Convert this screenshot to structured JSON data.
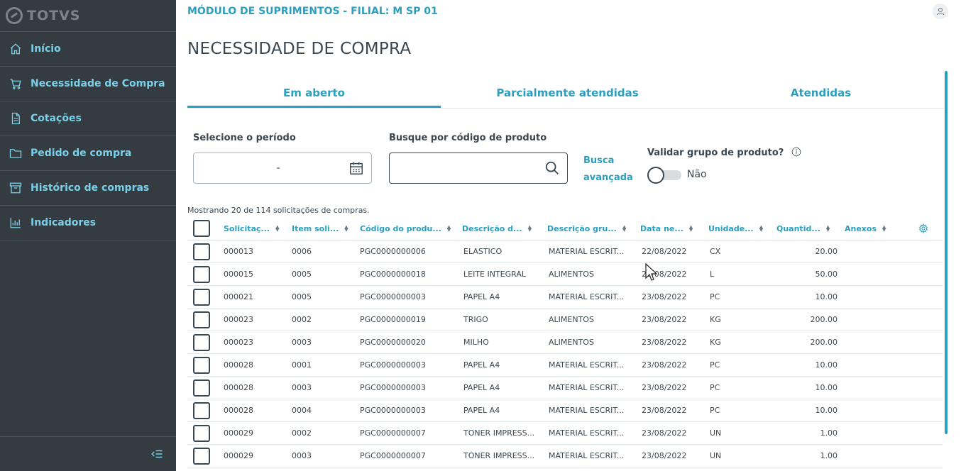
{
  "sidebar": {
    "logo": "TOTVS",
    "items": [
      {
        "label": "Início",
        "icon": "home-icon"
      },
      {
        "label": "Necessidade de Compra",
        "icon": "cart-icon"
      },
      {
        "label": "Cotações",
        "icon": "document-icon"
      },
      {
        "label": "Pedido de compra",
        "icon": "folder-icon"
      },
      {
        "label": "Histórico de compras",
        "icon": "archive-icon"
      },
      {
        "label": "Indicadores",
        "icon": "chart-icon"
      }
    ],
    "collapse_icon": "collapse-menu-icon"
  },
  "header": {
    "module": "MÓDULO DE SUPRIMENTOS - FILIAL: M SP 01",
    "page_title": "NECESSIDADE DE COMPRA"
  },
  "tabs": [
    {
      "label": "Em aberto",
      "active": true
    },
    {
      "label": "Parcialmente atendidas",
      "active": false
    },
    {
      "label": "Atendidas",
      "active": false
    }
  ],
  "filters": {
    "period_label": "Selecione o período",
    "period_value": "-",
    "search_label": "Busque por código de produto",
    "search_placeholder": "",
    "advanced_search": "Busca avançada",
    "validate_label": "Validar grupo de produto?",
    "toggle_value": "Não"
  },
  "count_text": "Mostrando 20 de 114 solicitações de compras.",
  "table": {
    "columns": [
      "Solicitaç...",
      "Item soli...",
      "Código do produ...",
      "Descrição d...",
      "Descrição gru...",
      "Data ne...",
      "Unidade...",
      "Quantid...",
      "Anexos"
    ],
    "rows": [
      [
        "000013",
        "0006",
        "PGC0000000006",
        "ELASTICO",
        "MATERIAL ESCRIT...",
        "22/08/2022",
        "CX",
        "20.00",
        ""
      ],
      [
        "000015",
        "0005",
        "PGC0000000018",
        "LEITE INTEGRAL",
        "ALIMENTOS",
        "23/08/2022",
        "L",
        "50.00",
        ""
      ],
      [
        "000021",
        "0005",
        "PGC0000000003",
        "PAPEL A4",
        "MATERIAL ESCRIT...",
        "23/08/2022",
        "PC",
        "10.00",
        ""
      ],
      [
        "000023",
        "0002",
        "PGC0000000019",
        "TRIGO",
        "ALIMENTOS",
        "23/08/2022",
        "KG",
        "200.00",
        ""
      ],
      [
        "000023",
        "0003",
        "PGC0000000020",
        "MILHO",
        "ALIMENTOS",
        "23/08/2022",
        "KG",
        "200.00",
        ""
      ],
      [
        "000028",
        "0001",
        "PGC0000000003",
        "PAPEL A4",
        "MATERIAL ESCRIT...",
        "23/08/2022",
        "PC",
        "10.00",
        ""
      ],
      [
        "000028",
        "0003",
        "PGC0000000003",
        "PAPEL A4",
        "MATERIAL ESCRIT...",
        "23/08/2022",
        "PC",
        "10.00",
        ""
      ],
      [
        "000028",
        "0004",
        "PGC0000000003",
        "PAPEL A4",
        "MATERIAL ESCRIT...",
        "23/08/2022",
        "PC",
        "10.00",
        ""
      ],
      [
        "000029",
        "0002",
        "PGC0000000007",
        "TONER IMPRESS...",
        "MATERIAL ESCRIT...",
        "23/08/2022",
        "UN",
        "1.00",
        ""
      ],
      [
        "000029",
        "0003",
        "PGC0000000007",
        "TONER IMPRESS...",
        "MATERIAL ESCRIT...",
        "23/08/2022",
        "UN",
        "1.00",
        ""
      ]
    ]
  },
  "colors": {
    "sidebar_bg": "#343c42",
    "accent": "#2a9fbf",
    "text": "#3b4750"
  }
}
